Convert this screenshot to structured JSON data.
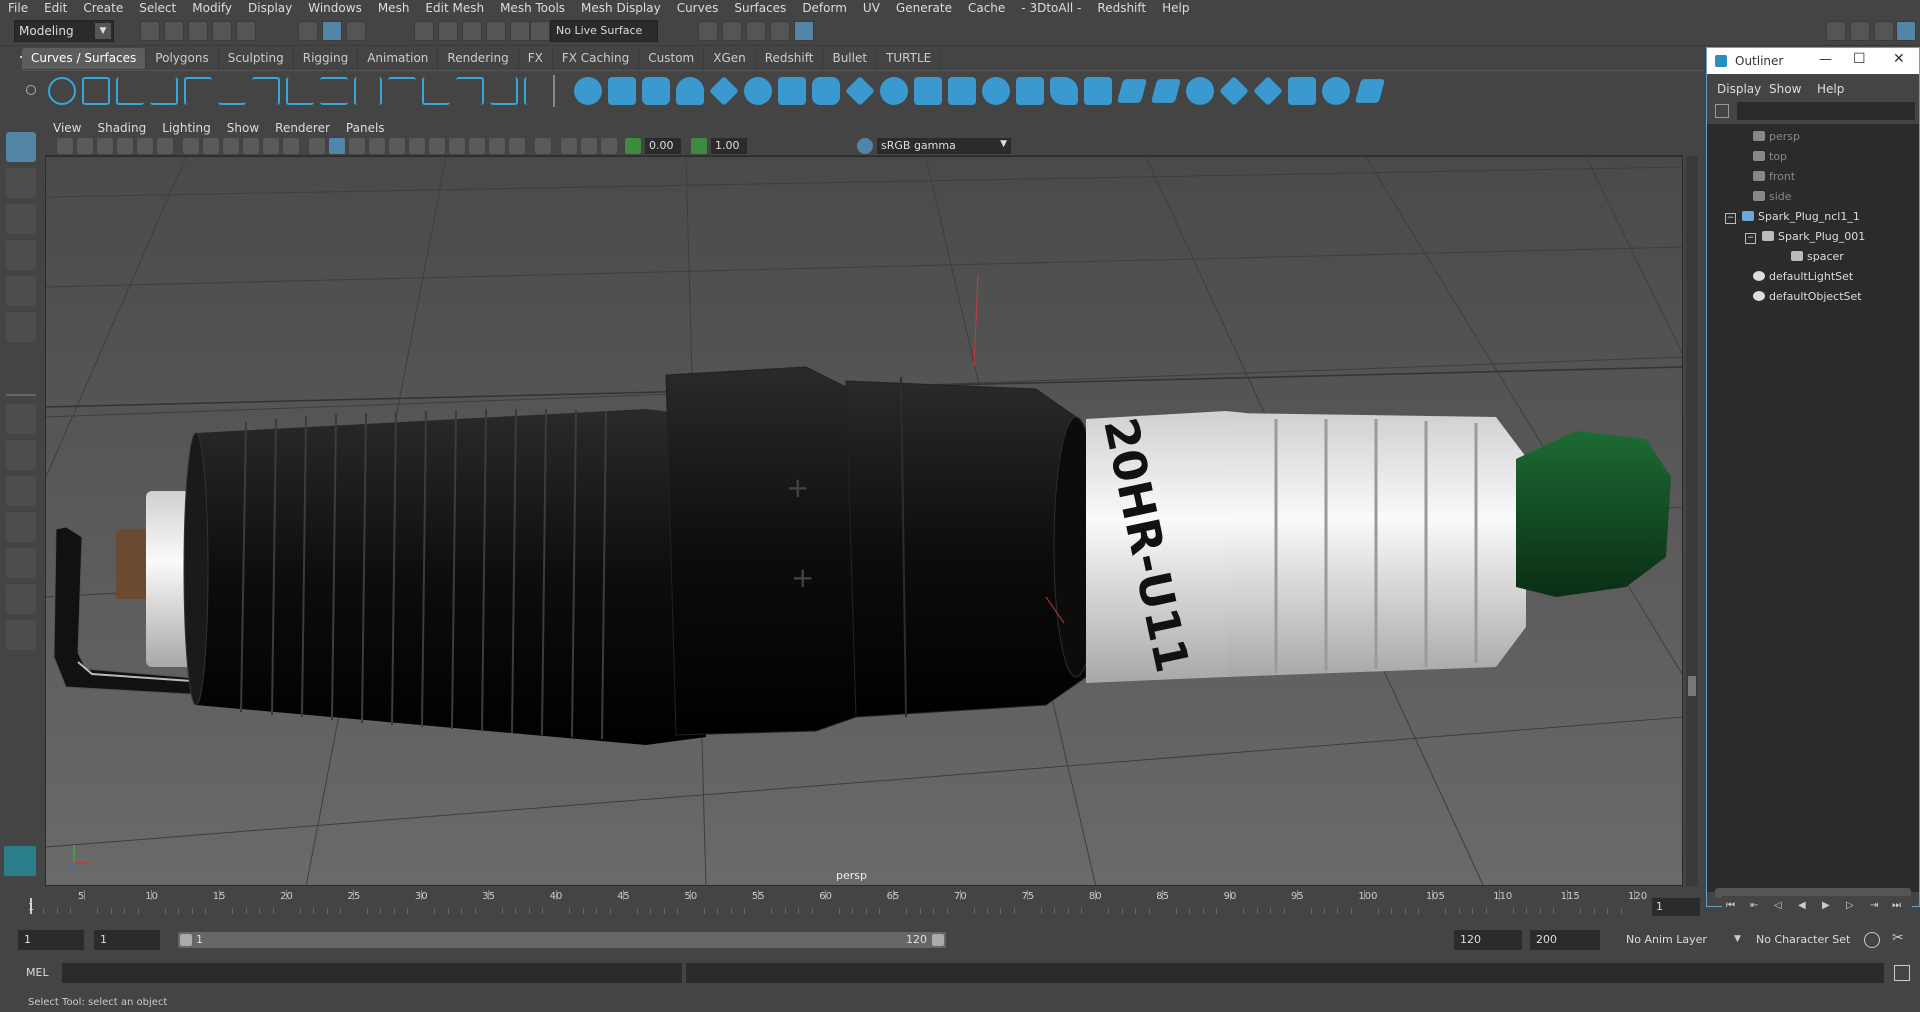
{
  "menubar": {
    "items": [
      "File",
      "Edit",
      "Create",
      "Select",
      "Modify",
      "Display",
      "Windows",
      "Mesh",
      "Edit Mesh",
      "Mesh Tools",
      "Mesh Display",
      "Curves",
      "Surfaces",
      "Deform",
      "UV",
      "Generate",
      "Cache",
      "- 3DtoAll -",
      "Redshift",
      "Help"
    ]
  },
  "statusline": {
    "mode": "Modeling",
    "live_surface": "No Live Surface"
  },
  "shelf": {
    "tabs": [
      "Curves / Surfaces",
      "Polygons",
      "Sculpting",
      "Rigging",
      "Animation",
      "Rendering",
      "FX",
      "FX Caching",
      "Custom",
      "XGen",
      "Redshift",
      "Bullet",
      "TURTLE"
    ],
    "active_tab": "Curves / Surfaces"
  },
  "panel": {
    "menus": [
      "View",
      "Shading",
      "Lighting",
      "Show",
      "Renderer",
      "Panels"
    ],
    "exposure": "0.00",
    "gamma": "1.00",
    "color_space": "sRGB gamma",
    "camera": "persp"
  },
  "model": {
    "engraving": "20HR-U11"
  },
  "outliner": {
    "title": "Outliner",
    "menus": [
      "Display",
      "Show",
      "Help"
    ],
    "items": [
      {
        "label": "persp",
        "kind": "camera"
      },
      {
        "label": "top",
        "kind": "camera"
      },
      {
        "label": "front",
        "kind": "camera"
      },
      {
        "label": "side",
        "kind": "camera"
      },
      {
        "label": "Spark_Plug_ncl1_1",
        "kind": "group"
      },
      {
        "label": "Spark_Plug_001",
        "kind": "mesh"
      },
      {
        "label": "spacer",
        "kind": "mesh"
      },
      {
        "label": "defaultLightSet",
        "kind": "set"
      },
      {
        "label": "defaultObjectSet",
        "kind": "set"
      }
    ]
  },
  "timeslider": {
    "ticks": [
      5,
      10,
      15,
      20,
      25,
      30,
      35,
      40,
      45,
      50,
      55,
      60,
      65,
      70,
      75,
      80,
      85,
      90,
      95,
      100,
      105,
      110,
      115,
      120
    ],
    "start_label": "1",
    "current_frame": "1"
  },
  "rangeslider": {
    "start_time": "1",
    "range_start": "1",
    "range_start_label": "1",
    "range_end_label": "120",
    "range_end": "120",
    "end_time": "200",
    "anim_layer": "No Anim Layer",
    "character_set": "No Character Set"
  },
  "cmdline": {
    "label": "MEL"
  },
  "helpline": {
    "text": "Select Tool: select an object"
  }
}
